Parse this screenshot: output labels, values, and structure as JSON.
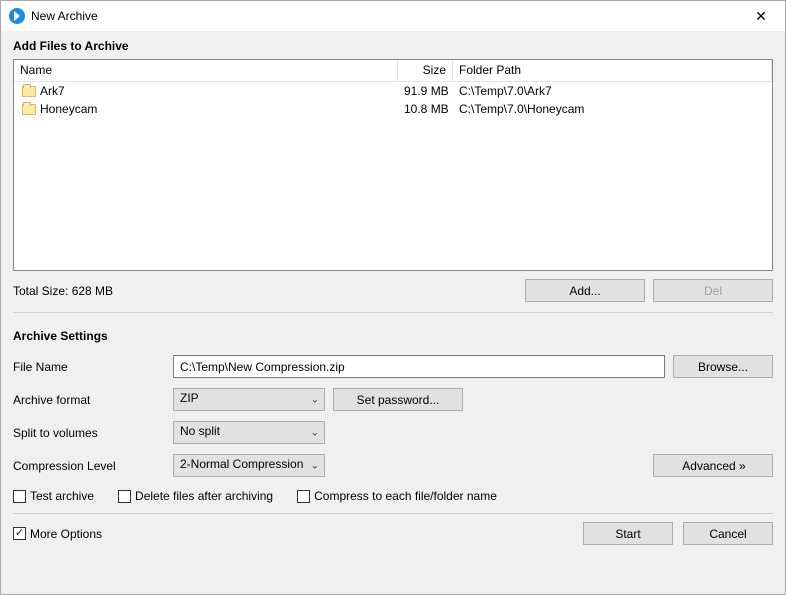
{
  "window": {
    "title": "New Archive"
  },
  "add_section": {
    "title": "Add Files to Archive",
    "columns": {
      "name": "Name",
      "size": "Size",
      "path": "Folder Path"
    },
    "rows": [
      {
        "name": "Ark7",
        "size": "91.9 MB",
        "path": "C:\\Temp\\7.0\\Ark7"
      },
      {
        "name": "Honeycam",
        "size": "10.8 MB",
        "path": "C:\\Temp\\7.0\\Honeycam"
      }
    ],
    "total_label": "Total Size: 628 MB",
    "add_btn": "Add...",
    "del_btn": "Del"
  },
  "archive_section": {
    "title": "Archive Settings",
    "filename_label": "File Name",
    "filename_value": "C:\\Temp\\New Compression.zip",
    "browse_btn": "Browse...",
    "format_label": "Archive format",
    "format_value": "ZIP",
    "setpw_btn": "Set password...",
    "split_label": "Split to volumes",
    "split_value": "No split",
    "level_label": "Compression Level",
    "level_value": "2-Normal Compression",
    "advanced_btn": "Advanced »",
    "test_label": "Test archive",
    "delete_label": "Delete files after archiving",
    "compress_each_label": "Compress to each file/folder name"
  },
  "bottom": {
    "more_options": "More Options",
    "start": "Start",
    "cancel": "Cancel"
  }
}
